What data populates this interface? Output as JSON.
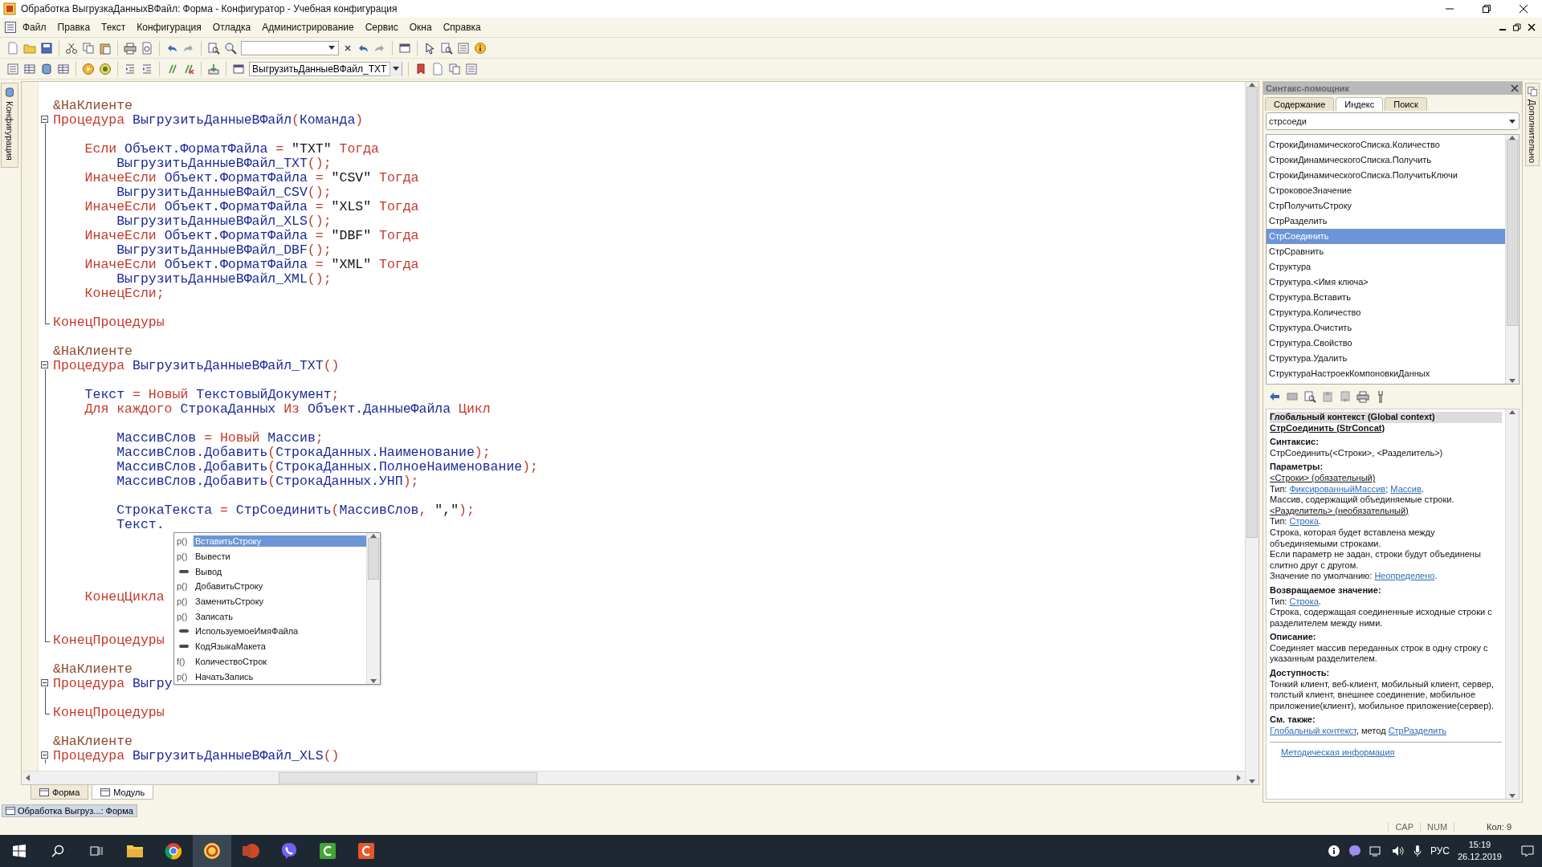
{
  "window": {
    "title": "Обработка ВыгрузкаДанныхВФайл: Форма - Конфигуратор - Учебная конфигурация"
  },
  "menu": [
    "Файл",
    "Правка",
    "Текст",
    "Конфигурация",
    "Отладка",
    "Администрирование",
    "Сервис",
    "Окна",
    "Справка"
  ],
  "toolbar": {
    "module_selector": {
      "value": "ВыгрузитьДанныеВФайл_TXT"
    }
  },
  "left_panel": {
    "label": "Конфигурация"
  },
  "editor": {
    "lines": [
      {
        "kind": "plain",
        "tokens": [
          {
            "kind": "pre",
            "text": "&НаКлиенте"
          }
        ]
      },
      {
        "kind": "block-start",
        "tokens": [
          {
            "kind": "kw",
            "text": "Процедура"
          },
          {
            "kind": "id",
            "text": " ВыгрузитьДанныеВФайл"
          },
          {
            "kind": "op",
            "text": "("
          },
          {
            "kind": "id",
            "text": "Команда"
          },
          {
            "kind": "op",
            "text": ")"
          }
        ]
      },
      {
        "kind": "block-body"
      },
      {
        "kind": "block-body",
        "tokens": [
          {
            "kind": "kw",
            "text": "    Если"
          },
          {
            "kind": "id",
            "text": " Объект.ФорматФайла"
          },
          {
            "kind": "op",
            "text": " ="
          },
          {
            "kind": "str",
            "text": " \"TXT\""
          },
          {
            "kind": "kw",
            "text": " Тогда"
          }
        ]
      },
      {
        "kind": "block-body",
        "tokens": [
          {
            "kind": "id",
            "text": "        ВыгрузитьДанныеВФайл_TXT"
          },
          {
            "kind": "op",
            "text": "();"
          }
        ]
      },
      {
        "kind": "block-body",
        "tokens": [
          {
            "kind": "kw",
            "text": "    ИначеЕсли"
          },
          {
            "kind": "id",
            "text": " Объект.ФорматФайла"
          },
          {
            "kind": "op",
            "text": " ="
          },
          {
            "kind": "str",
            "text": " \"CSV\""
          },
          {
            "kind": "kw",
            "text": " Тогда"
          }
        ]
      },
      {
        "kind": "block-body",
        "tokens": [
          {
            "kind": "id",
            "text": "        ВыгрузитьДанныеВФайл_CSV"
          },
          {
            "kind": "op",
            "text": "();"
          }
        ]
      },
      {
        "kind": "block-body",
        "tokens": [
          {
            "kind": "kw",
            "text": "    ИначеЕсли"
          },
          {
            "kind": "id",
            "text": " Объект.ФорматФайла"
          },
          {
            "kind": "op",
            "text": " ="
          },
          {
            "kind": "str",
            "text": " \"XLS\""
          },
          {
            "kind": "kw",
            "text": " Тогда"
          }
        ]
      },
      {
        "kind": "block-body",
        "tokens": [
          {
            "kind": "id",
            "text": "        ВыгрузитьДанныеВФайл_XLS"
          },
          {
            "kind": "op",
            "text": "();"
          }
        ]
      },
      {
        "kind": "block-body",
        "tokens": [
          {
            "kind": "kw",
            "text": "    ИначеЕсли"
          },
          {
            "kind": "id",
            "text": " Объект.ФорматФайла"
          },
          {
            "kind": "op",
            "text": " ="
          },
          {
            "kind": "str",
            "text": " \"DBF\""
          },
          {
            "kind": "kw",
            "text": " Тогда"
          }
        ]
      },
      {
        "kind": "block-body",
        "tokens": [
          {
            "kind": "id",
            "text": "        ВыгрузитьДанныеВФайл_DBF"
          },
          {
            "kind": "op",
            "text": "();"
          }
        ]
      },
      {
        "kind": "block-body",
        "tokens": [
          {
            "kind": "kw",
            "text": "    ИначеЕсли"
          },
          {
            "kind": "id",
            "text": " Объект.ФорматФайла"
          },
          {
            "kind": "op",
            "text": " ="
          },
          {
            "kind": "str",
            "text": " \"XML\""
          },
          {
            "kind": "kw",
            "text": " Тогда"
          }
        ]
      },
      {
        "kind": "block-body",
        "tokens": [
          {
            "kind": "id",
            "text": "        ВыгрузитьДанныеВФайл_XML"
          },
          {
            "kind": "op",
            "text": "();"
          }
        ]
      },
      {
        "kind": "block-body",
        "tokens": [
          {
            "kind": "kw",
            "text": "    КонецЕсли;"
          }
        ]
      },
      {
        "kind": "block-body"
      },
      {
        "kind": "block-end",
        "tokens": [
          {
            "kind": "kw",
            "text": "КонецПроцедуры"
          }
        ]
      },
      {
        "kind": "plain"
      },
      {
        "kind": "plain",
        "tokens": [
          {
            "kind": "pre",
            "text": "&НаКлиенте"
          }
        ]
      },
      {
        "kind": "block-start",
        "tokens": [
          {
            "kind": "kw",
            "text": "Процедура"
          },
          {
            "kind": "id",
            "text": " ВыгрузитьДанныеВФайл_TXT"
          },
          {
            "kind": "op",
            "text": "()"
          }
        ]
      },
      {
        "kind": "block-body"
      },
      {
        "kind": "block-body",
        "tokens": [
          {
            "kind": "id",
            "text": "    Текст"
          },
          {
            "kind": "op",
            "text": " ="
          },
          {
            "kind": "kw",
            "text": " Новый"
          },
          {
            "kind": "id",
            "text": " ТекстовыйДокумент"
          },
          {
            "kind": "op",
            "text": ";"
          }
        ]
      },
      {
        "kind": "block-body",
        "tokens": [
          {
            "kind": "kw",
            "text": "    Для каждого"
          },
          {
            "kind": "id",
            "text": " СтрокаДанных"
          },
          {
            "kind": "kw",
            "text": " Из"
          },
          {
            "kind": "id",
            "text": " Объект.ДанныеФайла"
          },
          {
            "kind": "kw",
            "text": " Цикл"
          }
        ]
      },
      {
        "kind": "block-body"
      },
      {
        "kind": "block-body",
        "tokens": [
          {
            "kind": "id",
            "text": "        МассивСлов"
          },
          {
            "kind": "op",
            "text": " ="
          },
          {
            "kind": "kw",
            "text": " Новый"
          },
          {
            "kind": "id",
            "text": " Массив"
          },
          {
            "kind": "op",
            "text": ";"
          }
        ]
      },
      {
        "kind": "block-body",
        "tokens": [
          {
            "kind": "id",
            "text": "        МассивСлов.Добавить"
          },
          {
            "kind": "op",
            "text": "("
          },
          {
            "kind": "id",
            "text": "СтрокаДанных.Наименование"
          },
          {
            "kind": "op",
            "text": ");"
          }
        ]
      },
      {
        "kind": "block-body",
        "tokens": [
          {
            "kind": "id",
            "text": "        МассивСлов.Добавить"
          },
          {
            "kind": "op",
            "text": "("
          },
          {
            "kind": "id",
            "text": "СтрокаДанных.ПолноеНаименование"
          },
          {
            "kind": "op",
            "text": ");"
          }
        ]
      },
      {
        "kind": "block-body",
        "tokens": [
          {
            "kind": "id",
            "text": "        МассивСлов.Добавить"
          },
          {
            "kind": "op",
            "text": "("
          },
          {
            "kind": "id",
            "text": "СтрокаДанных.УНП"
          },
          {
            "kind": "op",
            "text": ");"
          }
        ]
      },
      {
        "kind": "block-body"
      },
      {
        "kind": "block-body",
        "tokens": [
          {
            "kind": "id",
            "text": "        СтрокаТекста"
          },
          {
            "kind": "op",
            "text": " ="
          },
          {
            "kind": "id",
            "text": " СтрСоединить"
          },
          {
            "kind": "op",
            "text": "("
          },
          {
            "kind": "id",
            "text": "МассивСлов"
          },
          {
            "kind": "op",
            "text": ","
          },
          {
            "kind": "str",
            "text": " \",\""
          },
          {
            "kind": "op",
            "text": ");"
          }
        ]
      },
      {
        "kind": "block-body",
        "tokens": [
          {
            "kind": "id",
            "text": "        Текст."
          }
        ]
      },
      {
        "kind": "block-body"
      },
      {
        "kind": "block-body"
      },
      {
        "kind": "block-body"
      },
      {
        "kind": "block-body"
      },
      {
        "kind": "block-body",
        "tokens": [
          {
            "kind": "kw",
            "text": "    КонецЦикла"
          }
        ]
      },
      {
        "kind": "block-body"
      },
      {
        "kind": "block-body"
      },
      {
        "kind": "block-end",
        "tokens": [
          {
            "kind": "kw",
            "text": "КонецПроцедуры"
          }
        ]
      },
      {
        "kind": "plain"
      },
      {
        "kind": "plain",
        "tokens": [
          {
            "kind": "pre",
            "text": "&НаКлиенте"
          }
        ]
      },
      {
        "kind": "block-start",
        "tokens": [
          {
            "kind": "kw",
            "text": "Процедура"
          },
          {
            "kind": "id",
            "text": " Выгру"
          }
        ]
      },
      {
        "kind": "block-body"
      },
      {
        "kind": "block-end",
        "tokens": [
          {
            "kind": "kw",
            "text": "КонецПроцедуры"
          }
        ]
      },
      {
        "kind": "plain"
      },
      {
        "kind": "plain",
        "tokens": [
          {
            "kind": "pre",
            "text": "&НаКлиенте"
          }
        ]
      },
      {
        "kind": "block-start",
        "tokens": [
          {
            "kind": "kw",
            "text": "Процедура"
          },
          {
            "kind": "id",
            "text": " ВыгрузитьДанныеВФайл_XLS"
          },
          {
            "kind": "op",
            "text": "()"
          }
        ]
      }
    ],
    "autocomplete": {
      "items": [
        {
          "kind": "method",
          "marker": "p()",
          "label": "ВставитьСтроку",
          "selected": true
        },
        {
          "kind": "method",
          "marker": "p()",
          "label": "Вывести",
          "selected": false
        },
        {
          "kind": "property",
          "label": "Вывод",
          "selected": false
        },
        {
          "kind": "method",
          "marker": "p()",
          "label": "ДобавитьСтроку",
          "selected": false
        },
        {
          "kind": "method",
          "marker": "p()",
          "label": "ЗаменитьСтроку",
          "selected": false
        },
        {
          "kind": "method",
          "marker": "p()",
          "label": "Записать",
          "selected": false
        },
        {
          "kind": "property",
          "label": "ИспользуемоеИмяФайла",
          "selected": false
        },
        {
          "kind": "property",
          "label": "КодЯзыкаМакета",
          "selected": false
        },
        {
          "kind": "function",
          "marker": "f()",
          "label": "КоличествоСтрок",
          "selected": false
        },
        {
          "kind": "method",
          "marker": "p()",
          "label": "НачатьЗапись",
          "selected": false
        }
      ]
    }
  },
  "bottom_tabs": [
    {
      "label": "Форма",
      "selected": false
    },
    {
      "label": "Модуль",
      "selected": true
    }
  ],
  "window_tabs": [
    {
      "label": "Обработка Выгруз...: Форма",
      "selected": true
    }
  ],
  "syntax_helper": {
    "title": "Синтакс-помощник",
    "tabs": [
      {
        "label": "Содержание",
        "selected": false
      },
      {
        "label": "Индекс",
        "selected": true
      },
      {
        "label": "Поиск",
        "selected": false
      }
    ],
    "search": {
      "value": "стрсоеди"
    },
    "index": [
      {
        "label": "СтрокиДинамическогоСписка.Количество",
        "selected": false
      },
      {
        "label": "СтрокиДинамическогоСписка.Получить",
        "selected": false
      },
      {
        "label": "СтрокиДинамическогоСписка.ПолучитьКлючи",
        "selected": false
      },
      {
        "label": "СтроковоеЗначение",
        "selected": false
      },
      {
        "label": "СтрПолучитьСтроку",
        "selected": false
      },
      {
        "label": "СтрРазделить",
        "selected": false
      },
      {
        "label": "СтрСоединить",
        "selected": true
      },
      {
        "label": "СтрСравнить",
        "selected": false
      },
      {
        "label": "Структура",
        "selected": false
      },
      {
        "label": "Структура.<Имя ключа>",
        "selected": false
      },
      {
        "label": "Структура.Вставить",
        "selected": false
      },
      {
        "label": "Структура.Количество",
        "selected": false
      },
      {
        "label": "Структура.Очистить",
        "selected": false
      },
      {
        "label": "Структура.Свойство",
        "selected": false
      },
      {
        "label": "Структура.Удалить",
        "selected": false
      },
      {
        "label": "СтруктураНастроекКомпоновкиДанных",
        "selected": false
      }
    ],
    "help": [
      {
        "kind": "title",
        "text": "Глобальный контекст (Global context)"
      },
      {
        "kind": "title-link",
        "text": "СтрСоединить (StrConcat)"
      },
      {
        "kind": "heading",
        "text": "Синтаксис:"
      },
      {
        "kind": "text",
        "parts": [
          {
            "kind": "plain",
            "text": "СтрСоединить(<Строки>, <Разделитель>)"
          }
        ]
      },
      {
        "kind": "heading",
        "text": "Параметры:"
      },
      {
        "kind": "param",
        "text": "<Строки> (обязательный)"
      },
      {
        "kind": "text",
        "parts": [
          {
            "kind": "plain",
            "text": "Тип: "
          },
          {
            "kind": "link",
            "text": "ФиксированныйМассив"
          },
          {
            "kind": "plain",
            "text": "; "
          },
          {
            "kind": "link",
            "text": "Массив"
          },
          {
            "kind": "plain",
            "text": "."
          }
        ]
      },
      {
        "kind": "text",
        "parts": [
          {
            "kind": "plain",
            "text": "Массив, содержащий объединяемые строки."
          }
        ]
      },
      {
        "kind": "param",
        "text": "<Разделитель> (необязательный)"
      },
      {
        "kind": "text",
        "parts": [
          {
            "kind": "plain",
            "text": "Тип: "
          },
          {
            "kind": "link",
            "text": "Строка"
          },
          {
            "kind": "plain",
            "text": "."
          }
        ]
      },
      {
        "kind": "text",
        "parts": [
          {
            "kind": "plain",
            "text": "Строка, которая будет вставлена между объединяемыми строками."
          }
        ]
      },
      {
        "kind": "text",
        "parts": [
          {
            "kind": "plain",
            "text": "Если параметр не задан, строки будут объединены слитно друг с другом."
          }
        ]
      },
      {
        "kind": "text",
        "parts": [
          {
            "kind": "plain",
            "text": "Значение по умолчанию: "
          },
          {
            "kind": "link",
            "text": "Неопределено"
          },
          {
            "kind": "plain",
            "text": "."
          }
        ]
      },
      {
        "kind": "heading",
        "text": "Возвращаемое значение:"
      },
      {
        "kind": "text",
        "parts": [
          {
            "kind": "plain",
            "text": "Тип: "
          },
          {
            "kind": "link",
            "text": "Строка"
          },
          {
            "kind": "plain",
            "text": "."
          }
        ]
      },
      {
        "kind": "text",
        "parts": [
          {
            "kind": "plain",
            "text": "Строка, содержащая соединенные исходные строки с разделителем между ними."
          }
        ]
      },
      {
        "kind": "heading",
        "text": "Описание:"
      },
      {
        "kind": "text",
        "parts": [
          {
            "kind": "plain",
            "text": "Соединяет массив переданных строк в одну строку с указанным разделителем."
          }
        ]
      },
      {
        "kind": "heading",
        "text": "Доступность:"
      },
      {
        "kind": "text",
        "parts": [
          {
            "kind": "plain",
            "text": "Тонкий клиент, веб-клиент, мобильный клиент, сервер, толстый клиент, внешнее соединение, мобильное приложение(клиент), мобильное приложение(сервер)."
          }
        ]
      },
      {
        "kind": "heading",
        "text": "См. также:"
      },
      {
        "kind": "text",
        "parts": [
          {
            "kind": "link",
            "text": "Глобальный контекст"
          },
          {
            "kind": "plain",
            "text": ", метод "
          },
          {
            "kind": "link",
            "text": "СтрРазделить"
          }
        ]
      }
    ],
    "footer_link": "Методическая информация"
  },
  "right_edge_panel": {
    "label": "Дополнительно"
  },
  "status_bar": {
    "indicators": [
      "CAP",
      "NUM"
    ],
    "column": "Кол: 9"
  },
  "taskbar": {
    "language": "РУС",
    "time": "15:19",
    "date": "26.12.2019"
  }
}
